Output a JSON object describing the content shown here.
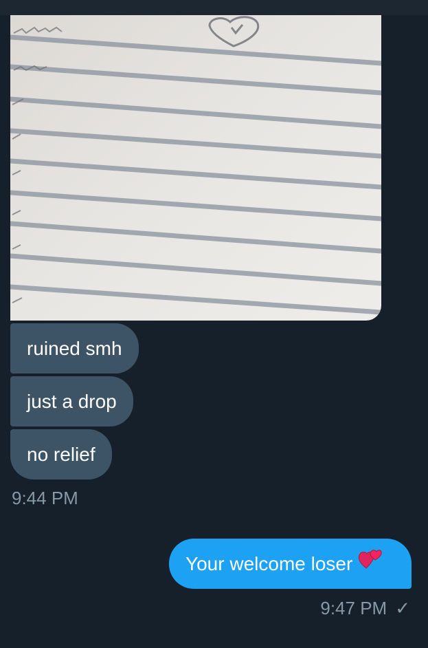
{
  "conversation": {
    "received": {
      "messages": [
        {
          "text": "ruined smh"
        },
        {
          "text": "just a drop"
        },
        {
          "text": "no relief"
        }
      ],
      "timestamp": "9:44 PM"
    },
    "sent": {
      "text": "Your welcome loser",
      "emoji_icon": "two-hearts-icon",
      "timestamp": "9:47 PM",
      "status_icon": "checkmark-icon",
      "status_glyph": "✓"
    }
  },
  "colors": {
    "background": "#15202b",
    "incoming_bubble": "#3d5466",
    "outgoing_bubble": "#1da1f2",
    "meta_text": "#8899a6"
  }
}
